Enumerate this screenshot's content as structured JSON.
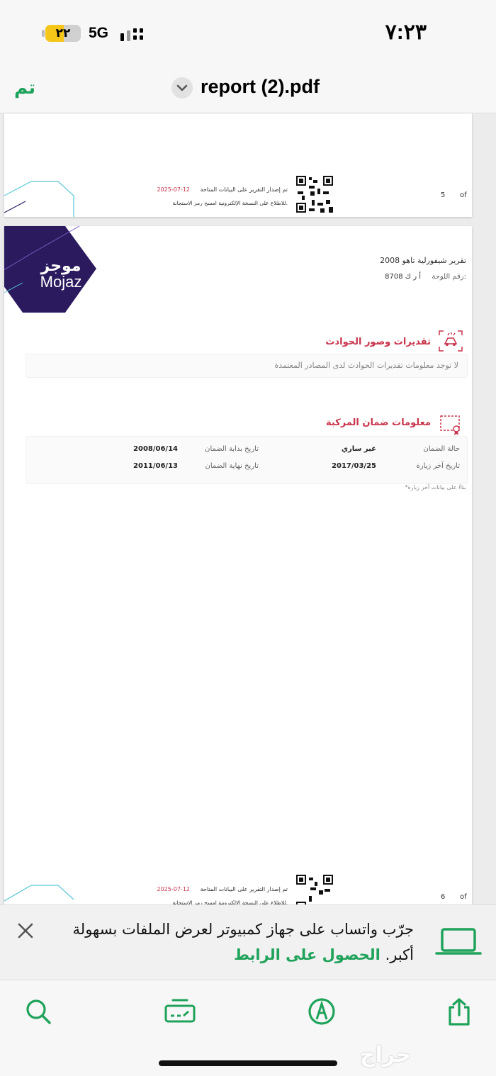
{
  "status_bar": {
    "time": "٧:٢٣",
    "battery_level": "٢٢",
    "battery_fraction": 0.22,
    "network": "5G"
  },
  "nav": {
    "done_label": "تم",
    "title": "report (2).pdf"
  },
  "page_top": {
    "issued_text": "تم إصدار التقرير على البيانات المتاحة",
    "issued_date": "2025-07-12",
    "scan_text": "للاطلاع على النسخة الإلكترونية امسح رمز الاستجابة.",
    "page_number": "5",
    "page_of": "of"
  },
  "page_main": {
    "logo_ar": "موجز",
    "logo_en": "Mojaz",
    "report_title": "تقرير شيفورلية تاهو 2008",
    "plate_label": "رقم اللوحة:",
    "plate_value": "أ ر ك 8708",
    "accidents": {
      "title": "تقديرات وصور الحوادث",
      "note": "لا توجد معلومات تقديرات الحوادث لدى المصادر المعتمدة"
    },
    "warranty": {
      "title": "معلومات ضمان المركبة",
      "status_label": "حالة الضمان",
      "status_value": "غير ساري",
      "start_label": "تاريخ بداية الضمان",
      "start_value": "2008/06/14",
      "last_visit_label": "تاريخ آخر زيارة",
      "last_visit_value": "2017/03/25",
      "end_label": "تاريخ نهاية الضمان",
      "end_value": "2011/06/13",
      "footnote": "*بناءً على بيانات آخر زيارة"
    },
    "footer": {
      "issued_text": "تم إصدار التقرير على البيانات المتاحة",
      "issued_date": "2025-07-12",
      "scan_text": "للاطلاع على النسخة الإلكترونية امسح رمز الاستجابة.",
      "page_number": "6",
      "page_of": "of"
    }
  },
  "banner": {
    "line1": "جرّب واتساب على جهاز كمبيوتر لعرض الملفات بسهولة",
    "line2_prefix": "أكبر.",
    "link": "الحصول على الرابط"
  },
  "toolbar": {
    "icons": [
      "search-icon",
      "text-edit-icon",
      "markup-pen-icon",
      "share-icon"
    ]
  },
  "watermark": "حراج",
  "colors": {
    "accent_green": "#1fa35a",
    "section_red": "#c8344b",
    "logo_purple": "#2b1a5e"
  }
}
